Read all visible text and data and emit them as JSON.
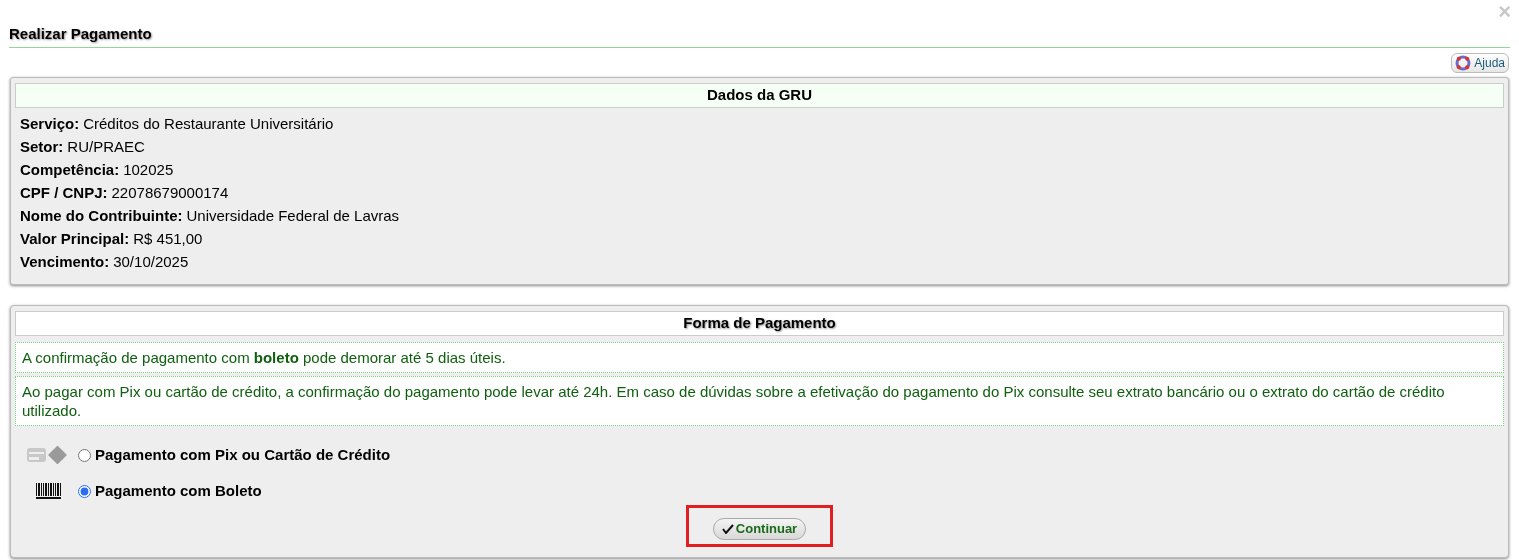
{
  "window": {
    "title": "Realizar Pagamento",
    "close": "×"
  },
  "help_button": {
    "label": "Ajuda"
  },
  "gru": {
    "title": "Dados da GRU",
    "fields": [
      {
        "label": "Serviço:",
        "value": "Créditos do Restaurante Universitário"
      },
      {
        "label": "Setor:",
        "value": "RU/PRAEC"
      },
      {
        "label": "Competência:",
        "value": "102025"
      },
      {
        "label": "CPF / CNPJ:",
        "value": "22078679000174"
      },
      {
        "label": "Nome do Contribuinte:",
        "value": "Universidade Federal de Lavras"
      },
      {
        "label": "Valor Principal:",
        "value": "R$ 451,00"
      },
      {
        "label": "Vencimento:",
        "value": "30/10/2025"
      }
    ]
  },
  "payment": {
    "title": "Forma de Pagamento",
    "notes": [
      "A confirmação de pagamento com **boleto** pode demorar até 5 dias úteis.",
      "Ao pagar com Pix ou cartão de crédito, a confirmação do pagamento pode levar até 24h. Em caso de dúvidas sobre a efetivação do pagamento do Pix consulte seu extrato bancário ou o extrato do cartão de crédito utilizado."
    ],
    "options": [
      {
        "kind": "card",
        "label": "Pagamento com Pix ou Cartão de Crédito",
        "selected": false
      },
      {
        "kind": "boleto",
        "label": "Pagamento com Boleto",
        "selected": true
      }
    ],
    "continue_button": {
      "label": "Continuar",
      "highlighted": true
    }
  }
}
